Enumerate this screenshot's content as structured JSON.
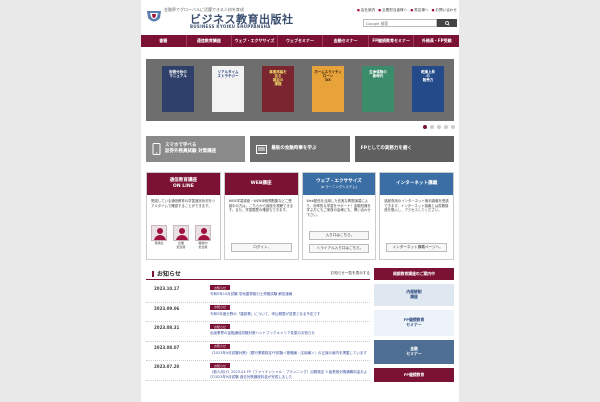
{
  "header": {
    "tagline": "金融界でグローバルに活躍できる人材を育成",
    "brand": "ビジネス教育出版社",
    "brand_en": "BUSINESS KYOIKU SHUPPANSHA",
    "top_links": [
      "会社案内",
      "企業担当者様へ",
      "書店様へ",
      "お問い合わせ"
    ],
    "search_placeholder": "Google 検索",
    "search_value": "Google 検索"
  },
  "nav": [
    "書籍",
    "通信教育講座",
    "ウェブ・エクササイズ",
    "ウェブセミナー",
    "金融セミナー",
    "FP継続教育セミナー",
    "外務員・FP受験"
  ],
  "slider": {
    "books": [
      {
        "title": "財務分析の\nマニュアル",
        "bg": "#2e3f6a",
        "fg": "#ffffff"
      },
      {
        "title": "リアルタイム\nストラテジー",
        "bg": "#f3f3f3",
        "fg": "#1f3b80"
      },
      {
        "title": "事業再編を\n巡る\n損益の\n課題",
        "bg": "#7a2530",
        "fg": "#f3dd6a"
      },
      {
        "title": "ホームエクイティ\nローン\nDX",
        "bg": "#e8a23a",
        "fg": "#3a2410"
      },
      {
        "title": "生命保険の\n新時代",
        "bg": "#3a8c6a",
        "fg": "#ffffff"
      },
      {
        "title": "乾燥上昇\nの\n販売力",
        "bg": "#244a8a",
        "fg": "#ffffff"
      }
    ],
    "dots": 5,
    "active_dot": 0
  },
  "banners": [
    {
      "text": "スマホで学べる\n証券外務員試験 対策講座"
    },
    {
      "text": "最新の金融時事を学ぶ"
    },
    {
      "text": "FPとしての実務力を磨く"
    }
  ],
  "boxes": [
    {
      "title": "通信教育講座",
      "subtitle": "ON LINE",
      "color": "#7b1133",
      "body": "受講している通信教育の学習進捗状況をリアルタイムで確認することができます。",
      "avatars": [
        "受講生",
        "企業\n担当者",
        "職場内\n担当者"
      ]
    },
    {
      "title": "WEB講座",
      "subtitle": "",
      "color": "#7b1133",
      "body": "WEB学習講座・WEB添削問題集などご受講中の方は、こちらから講座を視聴できます。また、学習履歴の確認もできます。",
      "button": "ログイン"
    },
    {
      "title": "ウェブ・エクササイズ",
      "subtitle": "(e-ラーニングシステム)",
      "color": "#3a6ea5",
      "body": "Web配信を活用した充実な問題演習により、効率的な学習をサポート！金融知識を学ぶ方にもご家族の皆様にも、問い合わせ下さい。",
      "buttons": [
        "入り口はこちら",
        "トライアル入り口はこちら"
      ]
    },
    {
      "title": "インターネット講義",
      "subtitle": "",
      "color": "#3a6ea5",
      "body": "講座専用のインターネット無料講義を受講できます。インターネット講義とは書籍講座を購入し、アクセスしてください。",
      "button": "インターネット講義ページへ"
    }
  ],
  "news": {
    "title": "お知らせ",
    "more": "お知らせ一覧を表示する",
    "items": [
      {
        "date": "2023.10.17",
        "badge": "お知らせ",
        "text": "令和5年10月試験 宅地建物取引士資格試験 解答速報"
      },
      {
        "date": "2023.09.06",
        "badge": "お知らせ",
        "text": "令和5年度分野の「建設業」について、申込期限が変更となる予定です"
      },
      {
        "date": "2023.08.31",
        "badge": "お知らせ",
        "text": "出版業界の金融通信試験対策ハンドブックキャリア変更のお知らせ"
      },
      {
        "date": "2023.08.07",
        "badge": "お知らせ",
        "text": "《2023年9月試験対策》（銀行業務検定FP試験＜基礎編・応用編＞）の正誤の案内を掲載しています"
      },
      {
        "date": "2023.07.20",
        "badge": "お知らせ",
        "text": "《新人向け》2023-24 FP（ファイナンシャル・プランニング）出題検定 3 級受検対策講義料金および2023年9月試験 過去対策講座料金が完成しました"
      }
    ]
  },
  "side": [
    {
      "text": "純銀教育講座のご案内中",
      "bg": "#7b1133",
      "fg": "#ffffff",
      "h": 12
    },
    {
      "text": "内部統制\n講座",
      "bg": "#dfe7f1",
      "fg": "#2c4a7a",
      "h": 22
    },
    {
      "text": "FP継続教育\nセミナー",
      "bg": "#eef3fa",
      "fg": "#2c4a7a",
      "h": 26
    },
    {
      "text": "金融\nセミナー",
      "bg": "#4f6e93",
      "fg": "#ffffff",
      "h": 24
    },
    {
      "text": "FP継続教育",
      "bg": "#7b1133",
      "fg": "#ffffff",
      "h": 14
    }
  ]
}
